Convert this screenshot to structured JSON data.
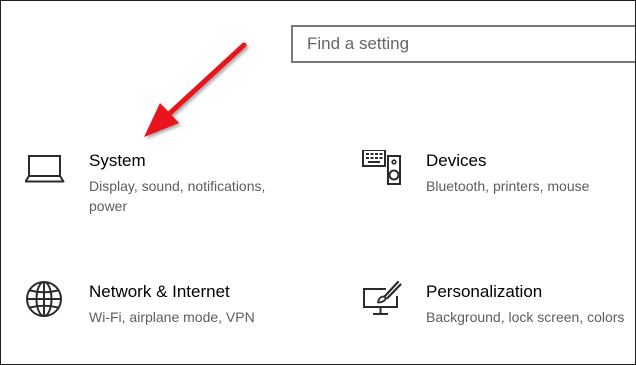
{
  "search": {
    "placeholder": "Find a setting"
  },
  "tiles": [
    {
      "icon": "laptop-icon",
      "title": "System",
      "description": "Display, sound, notifications, power"
    },
    {
      "icon": "keyboard-speaker-icon",
      "title": "Devices",
      "description": "Bluetooth, printers, mouse"
    },
    {
      "icon": "globe-icon",
      "title": "Network & Internet",
      "description": "Wi-Fi, airplane mode, VPN"
    },
    {
      "icon": "paint-monitor-icon",
      "title": "Personalization",
      "description": "Background, lock screen, colors"
    }
  ],
  "colors": {
    "icon": "#2b2b2b",
    "description": "#5d5d5d",
    "search_border": "#7a7a7a",
    "annotation_arrow": "#e8141b"
  },
  "annotation": {
    "type": "arrow",
    "points_to": "System"
  }
}
